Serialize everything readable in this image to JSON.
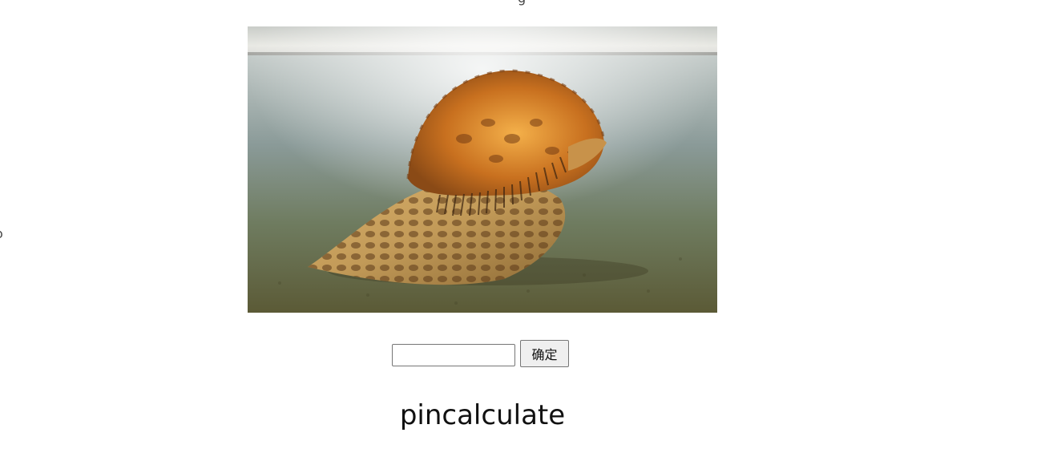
{
  "page": {
    "title_glyph_top": "g",
    "title_glyph_left": "o"
  },
  "image": {
    "alt": "conch shell in shallow water",
    "icon": "conch-shell-photo"
  },
  "form": {
    "input_value": "",
    "input_placeholder": "",
    "confirm_label": "确定"
  },
  "result": {
    "text": "pincalculate"
  }
}
